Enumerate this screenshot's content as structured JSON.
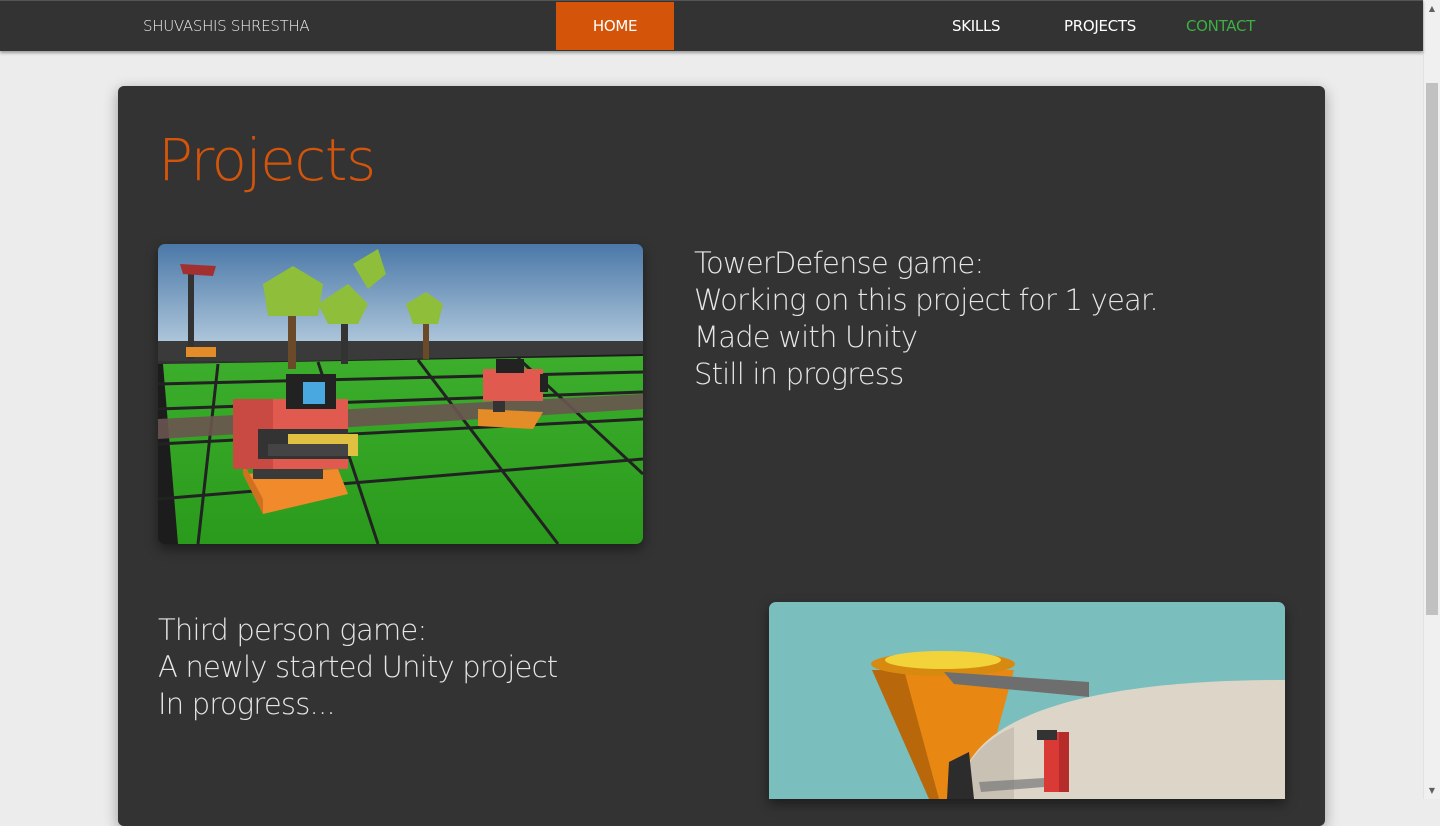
{
  "nav": {
    "brand": "SHUVASHIS SHRESTHA",
    "home": "HOME",
    "skills": "SKILLS",
    "projects": "PROJECTS",
    "contact": "CONTACT"
  },
  "main": {
    "title": "Projects",
    "projects": [
      {
        "lines": [
          "TowerDefense game:",
          "Working on this project for 1 year.",
          "Made with Unity",
          "Still in progress"
        ],
        "image": "towerdefense-game-screenshot"
      },
      {
        "lines": [
          "Third person game:",
          "A newly started Unity project",
          "In progress..."
        ],
        "image": "third-person-game-screenshot"
      }
    ]
  },
  "colors": {
    "accent": "#d4550a",
    "contact": "#3cb043",
    "navbar": "#333333",
    "card": "#333333",
    "page_bg": "#ececec"
  }
}
